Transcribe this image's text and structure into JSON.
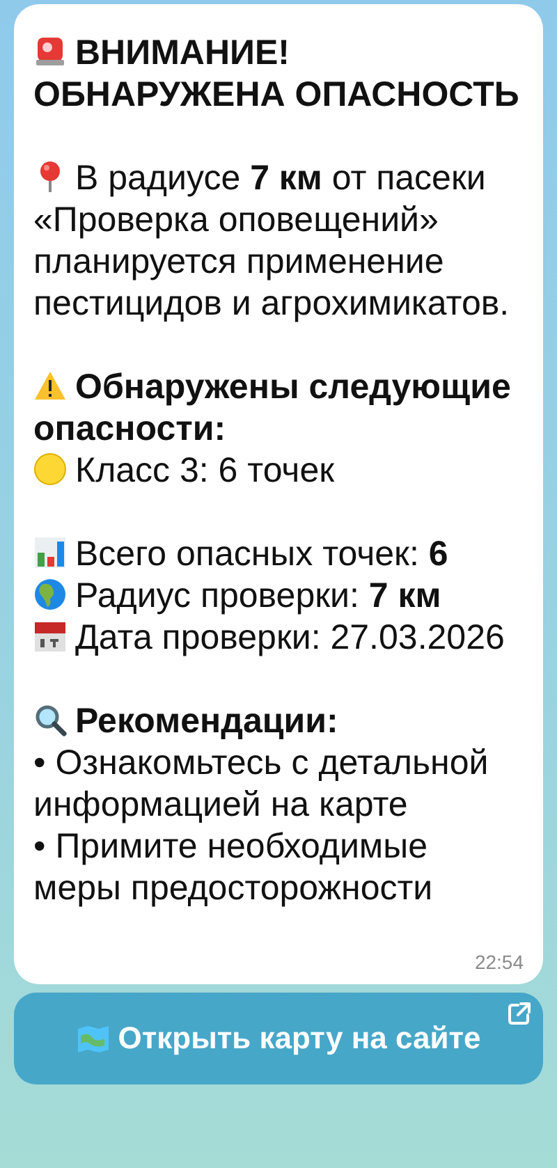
{
  "message": {
    "groups": [
      [
        {
          "kind": "alarm",
          "text": "ВНИМАНИЕ! ОБНАРУЖЕНА ОПАСНОСТЬ"
        }
      ],
      [
        {
          "kind": "pin",
          "text": "В радиусе **7 км** от пасеки «Проверка оповещений» планируется применение пестицидов и агрохимикатов."
        }
      ],
      [
        {
          "kind": "warning",
          "text": "Обнаружены следующие опасности:"
        },
        {
          "kind": "dot",
          "text": "Класс 3: 6 точек"
        }
      ],
      [
        {
          "kind": "chart",
          "text": "Всего опасных точек: **6**"
        },
        {
          "kind": "globe",
          "text": "Радиус проверки: **7 км**"
        },
        {
          "kind": "calendar",
          "text": "Дата проверки: 27.03.2026"
        }
      ],
      [
        {
          "kind": "search",
          "text": "Рекомендации:"
        },
        {
          "kind": "bullet",
          "text": "• Ознакомьтесь с детальной информацией на карте"
        },
        {
          "kind": "bullet",
          "text": "• Примите необходимые меры предосторожности"
        }
      ]
    ],
    "time": "22:54"
  },
  "button": {
    "label": "Открыть карту на сайте"
  }
}
